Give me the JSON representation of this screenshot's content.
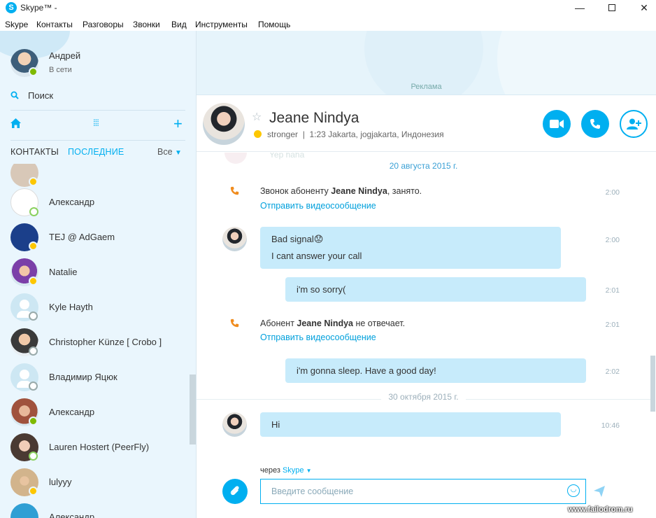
{
  "window": {
    "title": "Skype™ - ",
    "minimize_glyph": "—",
    "close_glyph": "✕"
  },
  "menu": [
    "Skype",
    "Контакты",
    "Разговоры",
    "Звонки",
    "Вид",
    "Инструменты",
    "Помощь"
  ],
  "profile": {
    "name": "Андрей",
    "status": "В сети"
  },
  "sidebar": {
    "search_label": "Поиск",
    "tab_contacts": "КОНТАКТЫ",
    "tab_recent": "ПОСЛЕДНИЕ",
    "filter_label": "Все",
    "contacts": [
      {
        "name": "Александр",
        "status": "offline",
        "avatar_color": "#ffffff"
      },
      {
        "name": "TEJ @ AdGaem",
        "status": "away",
        "avatar_color": "#1b3f8a"
      },
      {
        "name": "Natalie",
        "status": "away",
        "avatar_color": "#7b3fa8"
      },
      {
        "name": "Kyle Hayth",
        "status": "unknown",
        "avatar_color": "generic"
      },
      {
        "name": "Christopher Künze [ Crobo ]",
        "status": "unknown",
        "avatar_color": "#3a3a3a"
      },
      {
        "name": "Владимир Яцюк",
        "status": "unknown",
        "avatar_color": "generic"
      },
      {
        "name": "Александр",
        "status": "online",
        "avatar_color": "#a0523d"
      },
      {
        "name": "Lauren Hostert (PeerFly)",
        "status": "offline",
        "avatar_color": "#4a3a32"
      },
      {
        "name": "lulyyy",
        "status": "away",
        "avatar_color": "#d2b48c"
      },
      {
        "name": "Александр",
        "status": "away",
        "avatar_color": "#2f9fd4"
      }
    ]
  },
  "ad": {
    "label": "Реклама"
  },
  "conversation": {
    "contact_name": "Jeane Nindya",
    "mood": "stronger",
    "location": "1:23 Jakarta, jogjakarta, Индонезия",
    "ghost_text": "Yep haha",
    "date1": "20 августа 2015 г.",
    "date2": "30 октября 2015 г.",
    "events": [
      {
        "prefix": "Звонок абоненту ",
        "name": "Jeane Nindya",
        "suffix": ", занято.",
        "link": "Отправить видеосообщение",
        "time": "2:00"
      },
      {
        "prefix": "Абонент ",
        "name": "Jeane Nindya",
        "suffix": " не отвечает.",
        "link": "Отправить видеосообщение",
        "time": "2:01"
      }
    ],
    "messages": [
      {
        "line1": "Bad signal😟",
        "line2": "I cant answer your call",
        "time": "2:00"
      },
      {
        "line1": "i'm so sorry(",
        "time": "2:01"
      },
      {
        "line1": "i'm gonna sleep. Have a good day!",
        "time": "2:02"
      },
      {
        "line1": "Hi",
        "time": "10:46"
      }
    ]
  },
  "composer": {
    "via_label": "через",
    "via_service": "Skype",
    "placeholder": "Введите сообщение"
  },
  "watermark": "www.failodrom.ru",
  "colors": {
    "accent": "#00aff0",
    "bubble": "#c7ebfb",
    "sidebar_bg": "#eaf6fd",
    "missed_call": "#f08c1e",
    "status_online": "#7fba00",
    "status_away": "#fdc700"
  }
}
